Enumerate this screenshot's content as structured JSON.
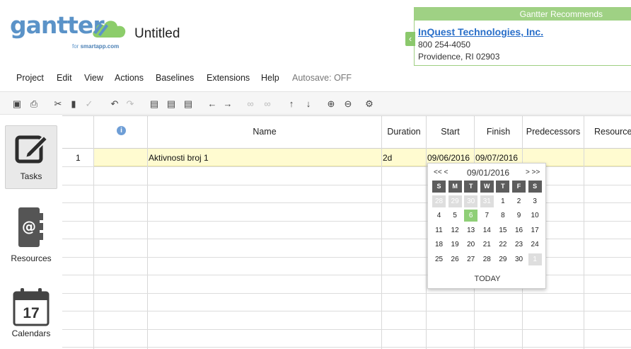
{
  "app": {
    "logo_text": "gantter",
    "logo_sub_prefix": "for ",
    "logo_sub_brand": "smartapp.com",
    "document_title": "Untitled"
  },
  "recommend": {
    "header": "Gantter Recommends",
    "company": "InQuest Technologies, Inc.",
    "phone": "800 254-4050",
    "city": "Providence, RI 02903"
  },
  "menu": {
    "items": [
      "Project",
      "Edit",
      "View",
      "Actions",
      "Baselines",
      "Extensions",
      "Help"
    ],
    "autosave": "Autosave: OFF"
  },
  "sidebar": {
    "tasks": "Tasks",
    "resources": "Resources",
    "calendars": "Calendars",
    "calendar_day": "17"
  },
  "grid": {
    "columns": [
      "Name",
      "Duration",
      "Start",
      "Finish",
      "Predecessors",
      "Resource"
    ],
    "info_icon_glyph": "i",
    "rows": [
      {
        "num": "1",
        "name": "Aktivnosti broj 1",
        "duration": "2d",
        "start": "09/06/2016",
        "finish": "09/07/2016"
      }
    ]
  },
  "datepicker": {
    "prev": "<< <",
    "next": "> >>",
    "month_label": "09/01/2016",
    "weekdays": [
      "S",
      "M",
      "T",
      "W",
      "T",
      "F",
      "S"
    ],
    "weeks": [
      [
        "28",
        "29",
        "30",
        "31",
        "1",
        "2",
        "3"
      ],
      [
        "4",
        "5",
        "6",
        "7",
        "8",
        "9",
        "10"
      ],
      [
        "11",
        "12",
        "13",
        "14",
        "15",
        "16",
        "17"
      ],
      [
        "18",
        "19",
        "20",
        "21",
        "22",
        "23",
        "24"
      ],
      [
        "25",
        "26",
        "27",
        "28",
        "29",
        "30",
        "1"
      ]
    ],
    "selected_day": "6",
    "today_label": "TODAY"
  },
  "colors": {
    "brand_blue": "#5b93c8",
    "recommend_green": "#9fd184",
    "selected_green": "#8fcf77",
    "row_highlight": "#fffbd0"
  }
}
